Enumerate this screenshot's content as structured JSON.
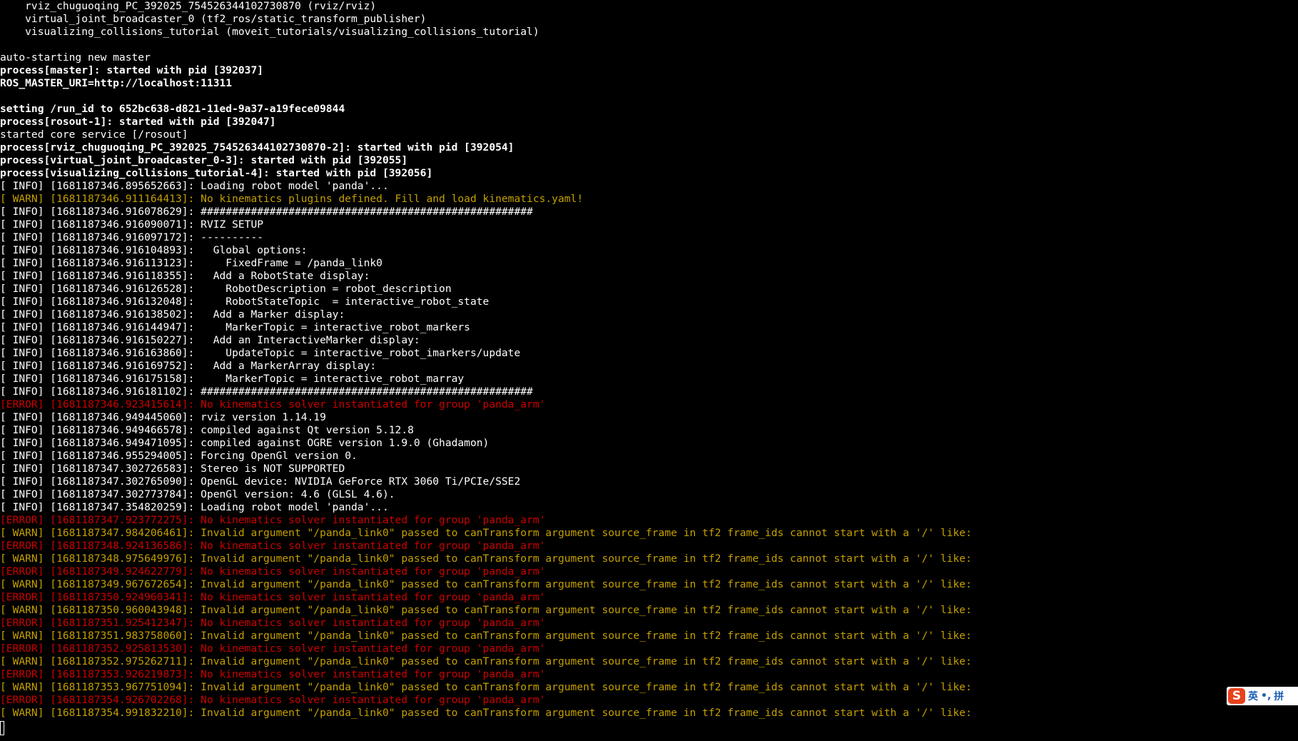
{
  "terminal": {
    "lines": [
      {
        "text": "    rviz_chuguoqing_PC_392025_754526344102730870 (rviz/rviz)",
        "type": "info",
        "bold": false
      },
      {
        "text": "    virtual_joint_broadcaster_0 (tf2_ros/static_transform_publisher)",
        "type": "info",
        "bold": false
      },
      {
        "text": "    visualizing_collisions_tutorial (moveit_tutorials/visualizing_collisions_tutorial)",
        "type": "info",
        "bold": false
      },
      {
        "text": "",
        "type": "info",
        "bold": false
      },
      {
        "text": "auto-starting new master",
        "type": "info",
        "bold": false
      },
      {
        "text": "process[master]: started with pid [392037]",
        "type": "info",
        "bold": true
      },
      {
        "text": "ROS_MASTER_URI=http://localhost:11311",
        "type": "info",
        "bold": true
      },
      {
        "text": "",
        "type": "info",
        "bold": false
      },
      {
        "text": "setting /run_id to 652bc638-d821-11ed-9a37-a19fece09844",
        "type": "info",
        "bold": true
      },
      {
        "text": "process[rosout-1]: started with pid [392047]",
        "type": "info",
        "bold": true
      },
      {
        "text": "started core service [/rosout]",
        "type": "info",
        "bold": false
      },
      {
        "text": "process[rviz_chuguoqing_PC_392025_754526344102730870-2]: started with pid [392054]",
        "type": "info",
        "bold": true
      },
      {
        "text": "process[virtual_joint_broadcaster_0-3]: started with pid [392055]",
        "type": "info",
        "bold": true
      },
      {
        "text": "process[visualizing_collisions_tutorial-4]: started with pid [392056]",
        "type": "info",
        "bold": true
      },
      {
        "text": "[ INFO] [1681187346.895652663]: Loading robot model 'panda'...",
        "type": "info",
        "bold": false
      },
      {
        "text": "[ WARN] [1681187346.911164413]: No kinematics plugins defined. Fill and load kinematics.yaml!",
        "type": "warn",
        "bold": false
      },
      {
        "text": "[ INFO] [1681187346.916078629]: #####################################################",
        "type": "info",
        "bold": false
      },
      {
        "text": "[ INFO] [1681187346.916090071]: RVIZ SETUP",
        "type": "info",
        "bold": false
      },
      {
        "text": "[ INFO] [1681187346.916097172]: ----------",
        "type": "info",
        "bold": false
      },
      {
        "text": "[ INFO] [1681187346.916104893]:   Global options:",
        "type": "info",
        "bold": false
      },
      {
        "text": "[ INFO] [1681187346.916113123]:     FixedFrame = /panda_link0",
        "type": "info",
        "bold": false
      },
      {
        "text": "[ INFO] [1681187346.916118355]:   Add a RobotState display:",
        "type": "info",
        "bold": false
      },
      {
        "text": "[ INFO] [1681187346.916126528]:     RobotDescription = robot_description",
        "type": "info",
        "bold": false
      },
      {
        "text": "[ INFO] [1681187346.916132048]:     RobotStateTopic  = interactive_robot_state",
        "type": "info",
        "bold": false
      },
      {
        "text": "[ INFO] [1681187346.916138502]:   Add a Marker display:",
        "type": "info",
        "bold": false
      },
      {
        "text": "[ INFO] [1681187346.916144947]:     MarkerTopic = interactive_robot_markers",
        "type": "info",
        "bold": false
      },
      {
        "text": "[ INFO] [1681187346.916150227]:   Add an InteractiveMarker display:",
        "type": "info",
        "bold": false
      },
      {
        "text": "[ INFO] [1681187346.916163860]:     UpdateTopic = interactive_robot_imarkers/update",
        "type": "info",
        "bold": false
      },
      {
        "text": "[ INFO] [1681187346.916169752]:   Add a MarkerArray display:",
        "type": "info",
        "bold": false
      },
      {
        "text": "[ INFO] [1681187346.916175158]:     MarkerTopic = interactive_robot_marray",
        "type": "info",
        "bold": false
      },
      {
        "text": "[ INFO] [1681187346.916181102]: #####################################################",
        "type": "info",
        "bold": false
      },
      {
        "text": "[ERROR] [1681187346.923415614]: No kinematics solver instantiated for group 'panda_arm'",
        "type": "error",
        "bold": false
      },
      {
        "text": "[ INFO] [1681187346.949445060]: rviz version 1.14.19",
        "type": "info",
        "bold": false
      },
      {
        "text": "[ INFO] [1681187346.949466578]: compiled against Qt version 5.12.8",
        "type": "info",
        "bold": false
      },
      {
        "text": "[ INFO] [1681187346.949471095]: compiled against OGRE version 1.9.0 (Ghadamon)",
        "type": "info",
        "bold": false
      },
      {
        "text": "[ INFO] [1681187346.955294005]: Forcing OpenGl version 0.",
        "type": "info",
        "bold": false
      },
      {
        "text": "[ INFO] [1681187347.302726583]: Stereo is NOT SUPPORTED",
        "type": "info",
        "bold": false
      },
      {
        "text": "[ INFO] [1681187347.302765090]: OpenGL device: NVIDIA GeForce RTX 3060 Ti/PCIe/SSE2",
        "type": "info",
        "bold": false
      },
      {
        "text": "[ INFO] [1681187347.302773784]: OpenGl version: 4.6 (GLSL 4.6).",
        "type": "info",
        "bold": false
      },
      {
        "text": "[ INFO] [1681187347.354820259]: Loading robot model 'panda'...",
        "type": "info",
        "bold": false
      },
      {
        "text": "[ERROR] [1681187347.923772275]: No kinematics solver instantiated for group 'panda_arm'",
        "type": "error",
        "bold": false
      },
      {
        "text": "[ WARN] [1681187347.984206461]: Invalid argument \"/panda_link0\" passed to canTransform argument source_frame in tf2 frame_ids cannot start with a '/' like:",
        "type": "warn",
        "bold": false
      },
      {
        "text": "[ERROR] [1681187348.924136586]: No kinematics solver instantiated for group 'panda_arm'",
        "type": "error",
        "bold": false
      },
      {
        "text": "[ WARN] [1681187348.975649976]: Invalid argument \"/panda_link0\" passed to canTransform argument source_frame in tf2 frame_ids cannot start with a '/' like:",
        "type": "warn",
        "bold": false
      },
      {
        "text": "[ERROR] [1681187349.924622779]: No kinematics solver instantiated for group 'panda_arm'",
        "type": "error",
        "bold": false
      },
      {
        "text": "[ WARN] [1681187349.967672654]: Invalid argument \"/panda_link0\" passed to canTransform argument source_frame in tf2 frame_ids cannot start with a '/' like:",
        "type": "warn",
        "bold": false
      },
      {
        "text": "[ERROR] [1681187350.924960341]: No kinematics solver instantiated for group 'panda_arm'",
        "type": "error",
        "bold": false
      },
      {
        "text": "[ WARN] [1681187350.960043948]: Invalid argument \"/panda_link0\" passed to canTransform argument source_frame in tf2 frame_ids cannot start with a '/' like:",
        "type": "warn",
        "bold": false
      },
      {
        "text": "[ERROR] [1681187351.925412347]: No kinematics solver instantiated for group 'panda_arm'",
        "type": "error",
        "bold": false
      },
      {
        "text": "[ WARN] [1681187351.983758060]: Invalid argument \"/panda_link0\" passed to canTransform argument source_frame in tf2 frame_ids cannot start with a '/' like:",
        "type": "warn",
        "bold": false
      },
      {
        "text": "[ERROR] [1681187352.925813530]: No kinematics solver instantiated for group 'panda_arm'",
        "type": "error",
        "bold": false
      },
      {
        "text": "[ WARN] [1681187352.975262711]: Invalid argument \"/panda_link0\" passed to canTransform argument source_frame in tf2 frame_ids cannot start with a '/' like:",
        "type": "warn",
        "bold": false
      },
      {
        "text": "[ERROR] [1681187353.926219873]: No kinematics solver instantiated for group 'panda_arm'",
        "type": "error",
        "bold": false
      },
      {
        "text": "[ WARN] [1681187353.967751094]: Invalid argument \"/panda_link0\" passed to canTransform argument source_frame in tf2 frame_ids cannot start with a '/' like:",
        "type": "warn",
        "bold": false
      },
      {
        "text": "[ERROR] [1681187354.926702268]: No kinematics solver instantiated for group 'panda_arm'",
        "type": "error",
        "bold": false
      },
      {
        "text": "[ WARN] [1681187354.991832210]: Invalid argument \"/panda_link0\" passed to canTransform argument source_frame in tf2 frame_ids cannot start with a '/' like:",
        "type": "warn",
        "bold": false
      }
    ]
  },
  "ime": {
    "logo": "S",
    "mode": "英",
    "punct": "•,",
    "input": "拼"
  },
  "colors": {
    "background": "#000000",
    "info": "#ffffff",
    "warn": "#c4a000",
    "error": "#cc0000"
  }
}
